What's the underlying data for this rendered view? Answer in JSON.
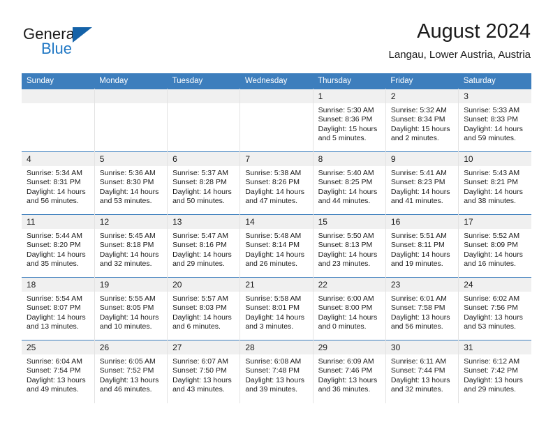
{
  "brand": {
    "name_part1": "General",
    "name_part2": "Blue",
    "flag_color": "#1462a8",
    "blue_color": "#1f77c4"
  },
  "header": {
    "title": "August 2024",
    "subtitle": "Langau, Lower Austria, Austria"
  },
  "theme": {
    "header_row_bg": "#3d7ebd",
    "daynum_bg": "#f0f0f0",
    "grid_line": "#e3e3e3",
    "text": "#1a1a1a"
  },
  "weekday_headers": [
    "Sunday",
    "Monday",
    "Tuesday",
    "Wednesday",
    "Thursday",
    "Friday",
    "Saturday"
  ],
  "weeks": [
    [
      {
        "day": "",
        "empty": true,
        "sunrise": "",
        "sunset": "",
        "daylight": "",
        "daylight2": ""
      },
      {
        "day": "",
        "empty": true,
        "sunrise": "",
        "sunset": "",
        "daylight": "",
        "daylight2": ""
      },
      {
        "day": "",
        "empty": true,
        "sunrise": "",
        "sunset": "",
        "daylight": "",
        "daylight2": ""
      },
      {
        "day": "",
        "empty": true,
        "sunrise": "",
        "sunset": "",
        "daylight": "",
        "daylight2": ""
      },
      {
        "day": "1",
        "empty": false,
        "sunrise": "Sunrise: 5:30 AM",
        "sunset": "Sunset: 8:36 PM",
        "daylight": "Daylight: 15 hours",
        "daylight2": "and 5 minutes."
      },
      {
        "day": "2",
        "empty": false,
        "sunrise": "Sunrise: 5:32 AM",
        "sunset": "Sunset: 8:34 PM",
        "daylight": "Daylight: 15 hours",
        "daylight2": "and 2 minutes."
      },
      {
        "day": "3",
        "empty": false,
        "sunrise": "Sunrise: 5:33 AM",
        "sunset": "Sunset: 8:33 PM",
        "daylight": "Daylight: 14 hours",
        "daylight2": "and 59 minutes."
      }
    ],
    [
      {
        "day": "4",
        "empty": false,
        "sunrise": "Sunrise: 5:34 AM",
        "sunset": "Sunset: 8:31 PM",
        "daylight": "Daylight: 14 hours",
        "daylight2": "and 56 minutes."
      },
      {
        "day": "5",
        "empty": false,
        "sunrise": "Sunrise: 5:36 AM",
        "sunset": "Sunset: 8:30 PM",
        "daylight": "Daylight: 14 hours",
        "daylight2": "and 53 minutes."
      },
      {
        "day": "6",
        "empty": false,
        "sunrise": "Sunrise: 5:37 AM",
        "sunset": "Sunset: 8:28 PM",
        "daylight": "Daylight: 14 hours",
        "daylight2": "and 50 minutes."
      },
      {
        "day": "7",
        "empty": false,
        "sunrise": "Sunrise: 5:38 AM",
        "sunset": "Sunset: 8:26 PM",
        "daylight": "Daylight: 14 hours",
        "daylight2": "and 47 minutes."
      },
      {
        "day": "8",
        "empty": false,
        "sunrise": "Sunrise: 5:40 AM",
        "sunset": "Sunset: 8:25 PM",
        "daylight": "Daylight: 14 hours",
        "daylight2": "and 44 minutes."
      },
      {
        "day": "9",
        "empty": false,
        "sunrise": "Sunrise: 5:41 AM",
        "sunset": "Sunset: 8:23 PM",
        "daylight": "Daylight: 14 hours",
        "daylight2": "and 41 minutes."
      },
      {
        "day": "10",
        "empty": false,
        "sunrise": "Sunrise: 5:43 AM",
        "sunset": "Sunset: 8:21 PM",
        "daylight": "Daylight: 14 hours",
        "daylight2": "and 38 minutes."
      }
    ],
    [
      {
        "day": "11",
        "empty": false,
        "sunrise": "Sunrise: 5:44 AM",
        "sunset": "Sunset: 8:20 PM",
        "daylight": "Daylight: 14 hours",
        "daylight2": "and 35 minutes."
      },
      {
        "day": "12",
        "empty": false,
        "sunrise": "Sunrise: 5:45 AM",
        "sunset": "Sunset: 8:18 PM",
        "daylight": "Daylight: 14 hours",
        "daylight2": "and 32 minutes."
      },
      {
        "day": "13",
        "empty": false,
        "sunrise": "Sunrise: 5:47 AM",
        "sunset": "Sunset: 8:16 PM",
        "daylight": "Daylight: 14 hours",
        "daylight2": "and 29 minutes."
      },
      {
        "day": "14",
        "empty": false,
        "sunrise": "Sunrise: 5:48 AM",
        "sunset": "Sunset: 8:14 PM",
        "daylight": "Daylight: 14 hours",
        "daylight2": "and 26 minutes."
      },
      {
        "day": "15",
        "empty": false,
        "sunrise": "Sunrise: 5:50 AM",
        "sunset": "Sunset: 8:13 PM",
        "daylight": "Daylight: 14 hours",
        "daylight2": "and 23 minutes."
      },
      {
        "day": "16",
        "empty": false,
        "sunrise": "Sunrise: 5:51 AM",
        "sunset": "Sunset: 8:11 PM",
        "daylight": "Daylight: 14 hours",
        "daylight2": "and 19 minutes."
      },
      {
        "day": "17",
        "empty": false,
        "sunrise": "Sunrise: 5:52 AM",
        "sunset": "Sunset: 8:09 PM",
        "daylight": "Daylight: 14 hours",
        "daylight2": "and 16 minutes."
      }
    ],
    [
      {
        "day": "18",
        "empty": false,
        "sunrise": "Sunrise: 5:54 AM",
        "sunset": "Sunset: 8:07 PM",
        "daylight": "Daylight: 14 hours",
        "daylight2": "and 13 minutes."
      },
      {
        "day": "19",
        "empty": false,
        "sunrise": "Sunrise: 5:55 AM",
        "sunset": "Sunset: 8:05 PM",
        "daylight": "Daylight: 14 hours",
        "daylight2": "and 10 minutes."
      },
      {
        "day": "20",
        "empty": false,
        "sunrise": "Sunrise: 5:57 AM",
        "sunset": "Sunset: 8:03 PM",
        "daylight": "Daylight: 14 hours",
        "daylight2": "and 6 minutes."
      },
      {
        "day": "21",
        "empty": false,
        "sunrise": "Sunrise: 5:58 AM",
        "sunset": "Sunset: 8:01 PM",
        "daylight": "Daylight: 14 hours",
        "daylight2": "and 3 minutes."
      },
      {
        "day": "22",
        "empty": false,
        "sunrise": "Sunrise: 6:00 AM",
        "sunset": "Sunset: 8:00 PM",
        "daylight": "Daylight: 14 hours",
        "daylight2": "and 0 minutes."
      },
      {
        "day": "23",
        "empty": false,
        "sunrise": "Sunrise: 6:01 AM",
        "sunset": "Sunset: 7:58 PM",
        "daylight": "Daylight: 13 hours",
        "daylight2": "and 56 minutes."
      },
      {
        "day": "24",
        "empty": false,
        "sunrise": "Sunrise: 6:02 AM",
        "sunset": "Sunset: 7:56 PM",
        "daylight": "Daylight: 13 hours",
        "daylight2": "and 53 minutes."
      }
    ],
    [
      {
        "day": "25",
        "empty": false,
        "sunrise": "Sunrise: 6:04 AM",
        "sunset": "Sunset: 7:54 PM",
        "daylight": "Daylight: 13 hours",
        "daylight2": "and 49 minutes."
      },
      {
        "day": "26",
        "empty": false,
        "sunrise": "Sunrise: 6:05 AM",
        "sunset": "Sunset: 7:52 PM",
        "daylight": "Daylight: 13 hours",
        "daylight2": "and 46 minutes."
      },
      {
        "day": "27",
        "empty": false,
        "sunrise": "Sunrise: 6:07 AM",
        "sunset": "Sunset: 7:50 PM",
        "daylight": "Daylight: 13 hours",
        "daylight2": "and 43 minutes."
      },
      {
        "day": "28",
        "empty": false,
        "sunrise": "Sunrise: 6:08 AM",
        "sunset": "Sunset: 7:48 PM",
        "daylight": "Daylight: 13 hours",
        "daylight2": "and 39 minutes."
      },
      {
        "day": "29",
        "empty": false,
        "sunrise": "Sunrise: 6:09 AM",
        "sunset": "Sunset: 7:46 PM",
        "daylight": "Daylight: 13 hours",
        "daylight2": "and 36 minutes."
      },
      {
        "day": "30",
        "empty": false,
        "sunrise": "Sunrise: 6:11 AM",
        "sunset": "Sunset: 7:44 PM",
        "daylight": "Daylight: 13 hours",
        "daylight2": "and 32 minutes."
      },
      {
        "day": "31",
        "empty": false,
        "sunrise": "Sunrise: 6:12 AM",
        "sunset": "Sunset: 7:42 PM",
        "daylight": "Daylight: 13 hours",
        "daylight2": "and 29 minutes."
      }
    ]
  ]
}
